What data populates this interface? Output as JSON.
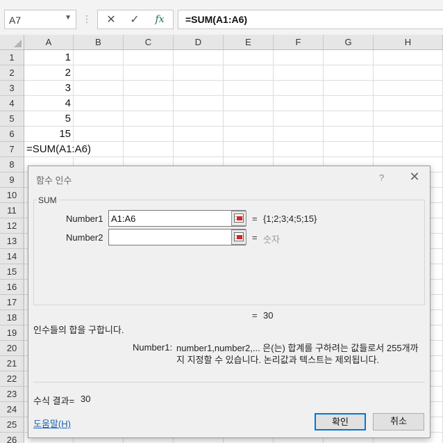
{
  "formula_bar": {
    "name_box": "A7",
    "dots": "⋮",
    "cancel_icon": "close-icon",
    "enter_icon": "checkmark-icon",
    "fx_label": "fx",
    "formula": "=SUM(A1:A6)"
  },
  "sheet": {
    "columns": [
      "A",
      "B",
      "C",
      "D",
      "E",
      "F",
      "G",
      "H"
    ],
    "rows": [
      "1",
      "2",
      "3",
      "4",
      "5",
      "6",
      "7",
      "8",
      "9",
      "10",
      "11",
      "12",
      "13",
      "14",
      "15",
      "16",
      "17",
      "18",
      "19",
      "20",
      "21",
      "22",
      "23",
      "24",
      "25",
      "26"
    ],
    "values": {
      "A1": "1",
      "A2": "2",
      "A3": "3",
      "A4": "4",
      "A5": "5",
      "A6": "15",
      "A7": "=SUM(A1:A6)"
    }
  },
  "dialog": {
    "title": "함수 인수",
    "help": "?",
    "close": "✕",
    "function_name": "SUM",
    "args": [
      {
        "label": "Number1",
        "value": "A1:A6",
        "eq": "=",
        "result": "{1;2;3;4;5;15}"
      },
      {
        "label": "Number2",
        "value": "",
        "eq": "=",
        "result": "숫자"
      }
    ],
    "total_eq": "=",
    "total_value": "30",
    "description": "인수들의 합을 구합니다.",
    "arg_desc_name": "Number1:",
    "arg_desc_text": "number1,number2,... 은(는) 합계를 구하려는 값들로서 255개까지 지정할 수 있습니다. 논리값과 텍스트는 제외됩니다.",
    "result_label": "수식 결과=",
    "result_value": "30",
    "help_link": "도움말(H)",
    "ok": "확인",
    "cancel": "취소"
  }
}
